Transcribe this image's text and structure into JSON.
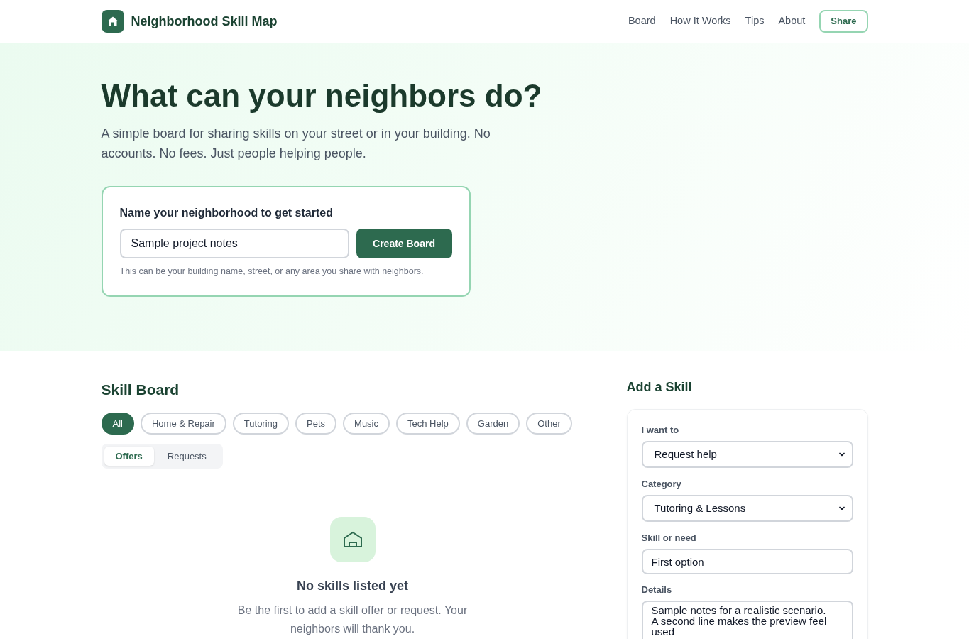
{
  "header": {
    "title": "Neighborhood Skill Map",
    "nav": [
      {
        "label": "Board"
      },
      {
        "label": "How It Works"
      },
      {
        "label": "Tips"
      },
      {
        "label": "About"
      }
    ],
    "share_button": "Share"
  },
  "hero": {
    "title": "What can your neighbors do?",
    "subtitle": "A simple board for sharing skills on your street or in your building. No accounts. No fees. Just people helping people.",
    "start_card": {
      "label": "Name your neighborhood to get started",
      "input": {
        "value": "Sample project notes"
      },
      "button": "Create Board",
      "hint": "This can be your building name, street, or any area you share with neighbors."
    }
  },
  "skill_board": {
    "title": "Skill Board",
    "filters": [
      {
        "label": "All",
        "selected": true
      },
      {
        "label": "Home & Repair",
        "selected": false
      },
      {
        "label": "Tutoring",
        "selected": false
      },
      {
        "label": "Pets",
        "selected": false
      },
      {
        "label": "Music",
        "selected": false
      },
      {
        "label": "Tech Help",
        "selected": false
      },
      {
        "label": "Garden",
        "selected": false
      },
      {
        "label": "Other",
        "selected": false
      }
    ],
    "tabs": [
      {
        "label": "Offers",
        "selected": true
      },
      {
        "label": "Requests",
        "selected": false
      }
    ],
    "empty_state": {
      "title": "No skills listed yet",
      "message": "Be the first to add a skill offer or request. Your neighbors will thank you."
    }
  },
  "add_skill": {
    "title": "Add a Skill",
    "fields": [
      {
        "kind": "select",
        "label": "I want to",
        "value": "Request help"
      },
      {
        "kind": "select",
        "label": "Category",
        "value": "Tutoring & Lessons"
      },
      {
        "kind": "input",
        "label": "Skill or need",
        "value": "First option"
      },
      {
        "kind": "textarea",
        "label": "Details",
        "value": "Sample notes for a realistic scenario.\nA second line makes the preview feel used"
      }
    ]
  }
}
